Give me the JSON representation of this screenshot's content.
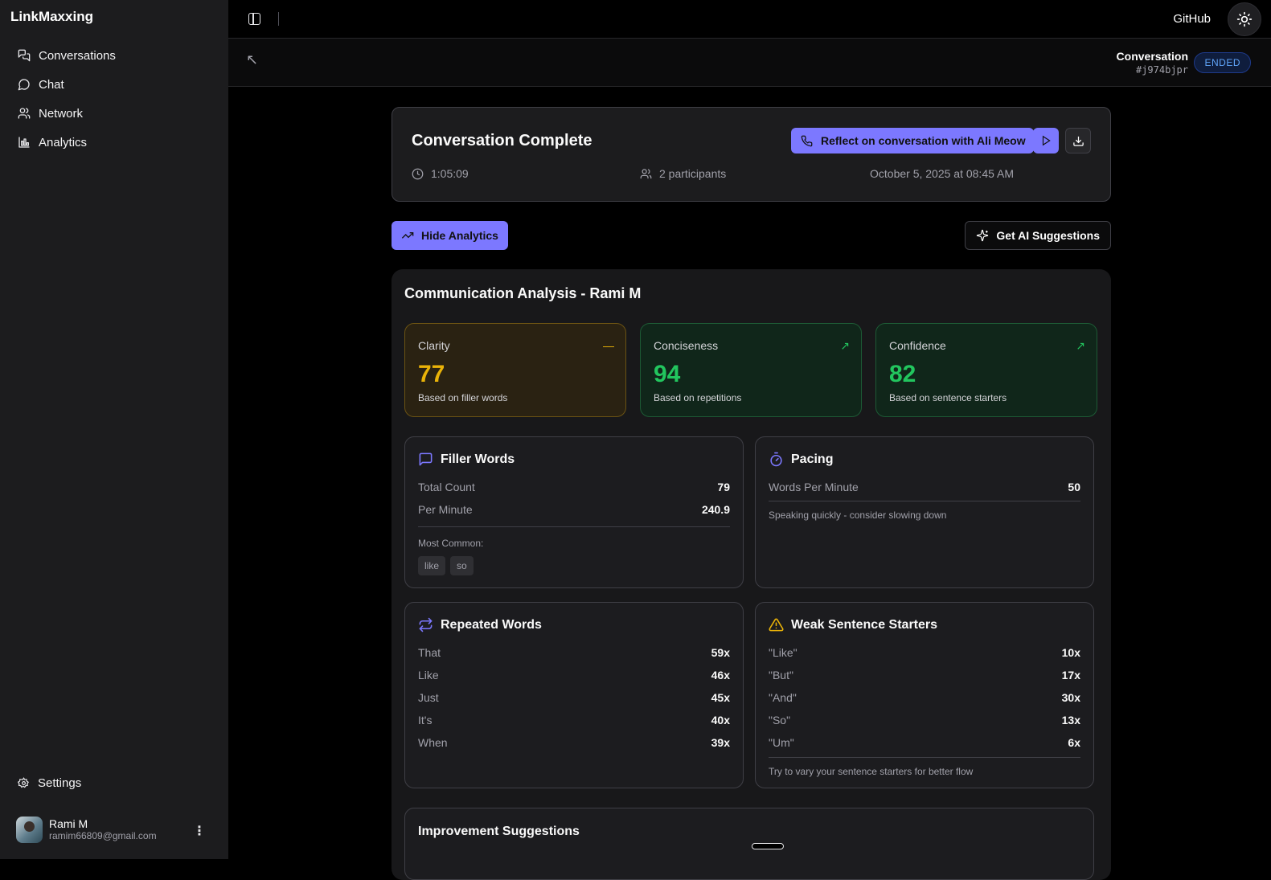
{
  "app": {
    "name": "LinkMaxxing"
  },
  "sidebar": {
    "items": [
      {
        "label": "Conversations",
        "icon": "conversations-icon"
      },
      {
        "label": "Chat",
        "icon": "chat-icon"
      },
      {
        "label": "Network",
        "icon": "network-icon"
      },
      {
        "label": "Analytics",
        "icon": "analytics-icon"
      }
    ],
    "settings_label": "Settings",
    "user": {
      "name": "Rami M",
      "email": "ramim66809@gmail.com"
    }
  },
  "topbar": {
    "github_label": "GitHub"
  },
  "subbar": {
    "title": "Conversation",
    "id": "#j974bjpr",
    "status": "ENDED"
  },
  "summary": {
    "title": "Conversation Complete",
    "reflect_label": "Reflect on conversation with Ali Meow",
    "duration": "1:05:09",
    "participants": "2 participants",
    "datetime": "October 5, 2025 at 08:45 AM"
  },
  "actions": {
    "hide_analytics": "Hide Analytics",
    "ai_suggestions": "Get AI Suggestions"
  },
  "analysis": {
    "title": "Communication Analysis - Rami M",
    "scores": [
      {
        "label": "Clarity",
        "value": "77",
        "sub": "Based on filler words",
        "trend": "flat",
        "color": "#eab308"
      },
      {
        "label": "Conciseness",
        "value": "94",
        "sub": "Based on repetitions",
        "trend": "up",
        "color": "#22c55e"
      },
      {
        "label": "Confidence",
        "value": "82",
        "sub": "Based on sentence starters",
        "trend": "up",
        "color": "#22c55e"
      }
    ],
    "filler": {
      "title": "Filler Words",
      "total_label": "Total Count",
      "total_value": "79",
      "per_min_label": "Per Minute",
      "per_min_value": "240.9",
      "common_label": "Most Common:",
      "common": [
        "like",
        "so"
      ]
    },
    "pacing": {
      "title": "Pacing",
      "wpm_label": "Words Per Minute",
      "wpm_value": "50",
      "note": "Speaking quickly - consider slowing down"
    },
    "repeated": {
      "title": "Repeated Words",
      "rows": [
        {
          "word": "That",
          "count": "59x"
        },
        {
          "word": "Like",
          "count": "46x"
        },
        {
          "word": "Just",
          "count": "45x"
        },
        {
          "word": "It's",
          "count": "40x"
        },
        {
          "word": "When",
          "count": "39x"
        }
      ]
    },
    "weak": {
      "title": "Weak Sentence Starters",
      "rows": [
        {
          "word": "\"Like\"",
          "count": "10x"
        },
        {
          "word": "\"But\"",
          "count": "17x"
        },
        {
          "word": "\"And\"",
          "count": "30x"
        },
        {
          "word": "\"So\"",
          "count": "13x"
        },
        {
          "word": "\"Um\"",
          "count": "6x"
        }
      ],
      "note": "Try to vary your sentence starters for better flow"
    },
    "improvement_title": "Improvement Suggestions"
  }
}
